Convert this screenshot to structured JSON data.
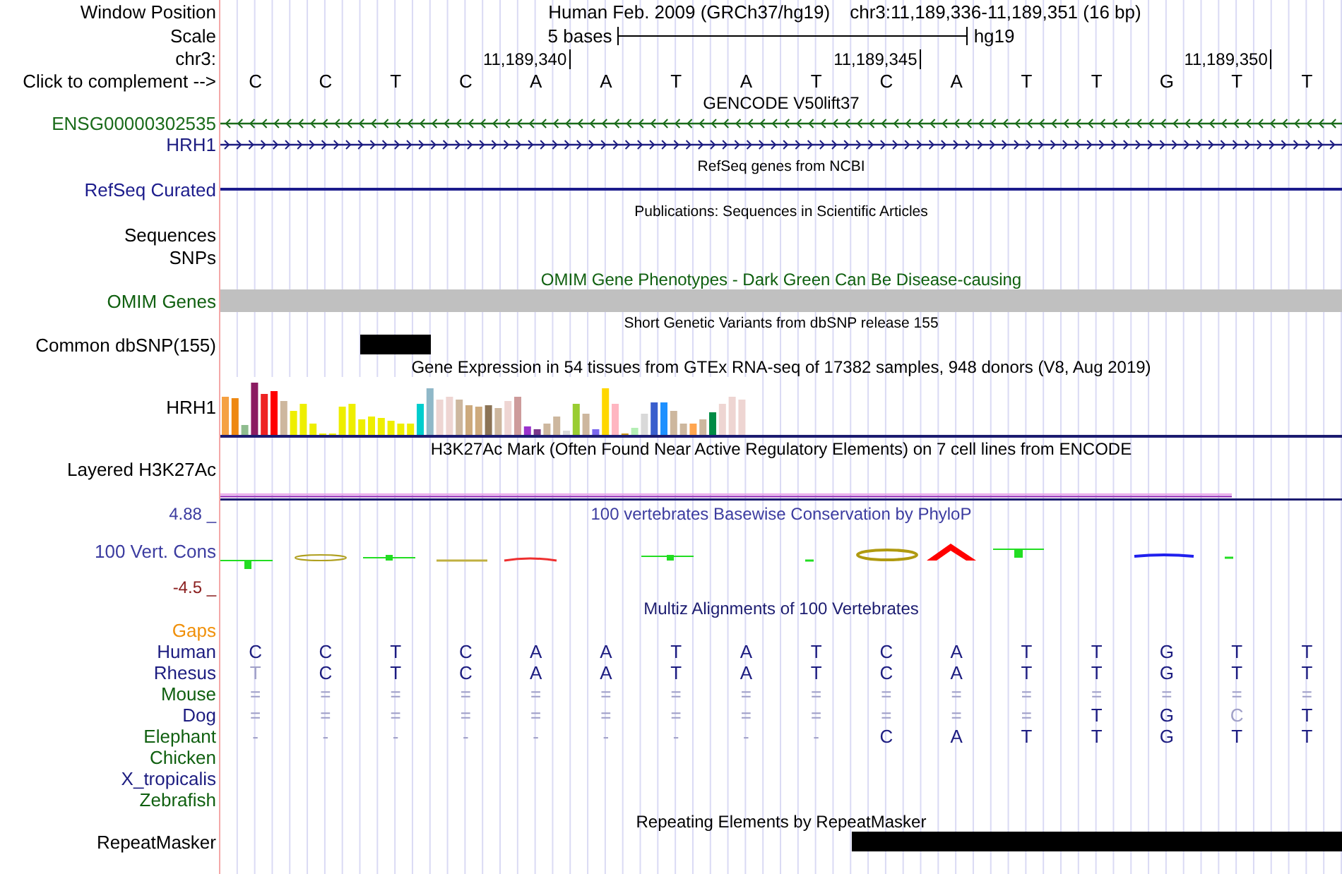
{
  "sequence": [
    {
      "base": "C"
    },
    {
      "base": "C"
    },
    {
      "base": "T"
    },
    {
      "base": "C"
    },
    {
      "base": "A",
      "coordinate": "11,189,340"
    },
    {
      "base": "A"
    },
    {
      "base": "T"
    },
    {
      "base": "A"
    },
    {
      "base": "T"
    },
    {
      "base": "C",
      "coordinate": "11,189,345"
    },
    {
      "base": "A"
    },
    {
      "base": "T"
    },
    {
      "base": "T"
    },
    {
      "base": "G"
    },
    {
      "base": "T",
      "coordinate": "11,189,350"
    },
    {
      "base": "T"
    }
  ],
  "rows": [
    {
      "kind": "position",
      "label": "Window Position",
      "assembly": "Human Feb. 2009 (GRCh37/hg19)",
      "range": "chr3:11,189,336-11,189,351 (16 bp)"
    },
    {
      "kind": "scale",
      "label": "Scale",
      "scale": "5 bases",
      "db": "hg19"
    },
    {
      "kind": "ruler",
      "label": "chr3:"
    },
    {
      "kind": "bases",
      "label": "Click to complement -->"
    },
    {
      "kind": "title",
      "text": "GENCODE V50lift37"
    },
    {
      "kind": "gene_reverse",
      "label": "ENSG00000302535",
      "color": "#1a6b1a"
    },
    {
      "kind": "gene_forward",
      "label": "HRH1",
      "color": "#1c1c80"
    },
    {
      "kind": "small_title",
      "text": "RefSeq genes from NCBI"
    },
    {
      "kind": "line",
      "label": "RefSeq Curated",
      "color": "#1c1c8c"
    },
    {
      "kind": "small_title",
      "text": "Publications: Sequences in Scientific Articles"
    },
    {
      "kind": "empty",
      "label": "Sequences"
    },
    {
      "kind": "empty",
      "label": "SNPs"
    },
    {
      "kind": "title",
      "text": "OMIM Gene Phenotypes - Dark Green Can Be Disease-causing",
      "color": "#106010"
    },
    {
      "kind": "band",
      "label": "OMIM Genes",
      "color": "#106010"
    },
    {
      "kind": "small_title",
      "text": "Short Genetic Variants from dbSNP release 155"
    },
    {
      "kind": "blocks",
      "label": "Common dbSNP(155)",
      "covered": [
        false,
        false,
        true,
        false,
        false,
        false,
        false,
        false,
        false,
        false,
        false,
        false,
        false,
        false,
        false,
        false
      ]
    },
    {
      "kind": "title",
      "text": "Gene Expression in 54 tissues from GTEx RNA-seq of 17382 samples, 948 donors (V8, Aug 2019)"
    },
    {
      "kind": "expression",
      "label": "HRH1"
    },
    {
      "kind": "title",
      "text": "H3K27Ac Mark (Often Found Near Active Regulatory Elements) on 7 cell lines from ENCODE"
    },
    {
      "kind": "layered",
      "label": "Layered H3K27Ac"
    },
    {
      "kind": "conservation",
      "label": "100 Vert. Cons",
      "color": "#3c3ca0",
      "title": "100 vertebrates Basewise Conservation by PhyloP",
      "max": "4.88 _",
      "min": "-4.5 _"
    },
    {
      "kind": "title",
      "text": "Multiz Alignments of 100 Vertebrates",
      "color": "#1c1c70"
    },
    {
      "kind": "empty",
      "label": "Gaps",
      "color": "#f0900a"
    },
    {
      "kind": "alignment",
      "label": "Human",
      "color": "#1c1c80",
      "bases": [
        {
          "base": "C",
          "faded": false
        },
        {
          "base": "C",
          "faded": false
        },
        {
          "base": "T",
          "faded": false
        },
        {
          "base": "C",
          "faded": false
        },
        {
          "base": "A",
          "faded": false
        },
        {
          "base": "A",
          "faded": false
        },
        {
          "base": "T",
          "faded": false
        },
        {
          "base": "A",
          "faded": false
        },
        {
          "base": "T",
          "faded": false
        },
        {
          "base": "C",
          "faded": false
        },
        {
          "base": "A",
          "faded": false
        },
        {
          "base": "T",
          "faded": false
        },
        {
          "base": "T",
          "faded": false
        },
        {
          "base": "G",
          "faded": false
        },
        {
          "base": "T",
          "faded": false
        },
        {
          "base": "T",
          "faded": false
        }
      ]
    },
    {
      "kind": "alignment",
      "label": "Rhesus",
      "color": "#1c1c80",
      "bases": [
        {
          "base": "T",
          "faded": true
        },
        {
          "base": "C",
          "faded": false
        },
        {
          "base": "T",
          "faded": false
        },
        {
          "base": "C",
          "faded": false
        },
        {
          "base": "A",
          "faded": false
        },
        {
          "base": "A",
          "faded": false
        },
        {
          "base": "T",
          "faded": false
        },
        {
          "base": "A",
          "faded": false
        },
        {
          "base": "T",
          "faded": false
        },
        {
          "base": "C",
          "faded": false
        },
        {
          "base": "A",
          "faded": false
        },
        {
          "base": "T",
          "faded": false
        },
        {
          "base": "T",
          "faded": false
        },
        {
          "base": "G",
          "faded": false
        },
        {
          "base": "T",
          "faded": false
        },
        {
          "base": "T",
          "faded": false
        }
      ]
    },
    {
      "kind": "alignment",
      "label": "Mouse",
      "color": "#106010",
      "bases": [
        {
          "base": "=",
          "faded": true
        },
        {
          "base": "=",
          "faded": true
        },
        {
          "base": "=",
          "faded": true
        },
        {
          "base": "=",
          "faded": true
        },
        {
          "base": "=",
          "faded": true
        },
        {
          "base": "=",
          "faded": true
        },
        {
          "base": "=",
          "faded": true
        },
        {
          "base": "=",
          "faded": true
        },
        {
          "base": "=",
          "faded": true
        },
        {
          "base": "=",
          "faded": true
        },
        {
          "base": "=",
          "faded": true
        },
        {
          "base": "=",
          "faded": true
        },
        {
          "base": "=",
          "faded": true
        },
        {
          "base": "=",
          "faded": true
        },
        {
          "base": "=",
          "faded": true
        },
        {
          "base": "=",
          "faded": true
        }
      ]
    },
    {
      "kind": "alignment",
      "label": "Dog",
      "color": "#1c1c80",
      "bases": [
        {
          "base": "=",
          "faded": true
        },
        {
          "base": "=",
          "faded": true
        },
        {
          "base": "=",
          "faded": true
        },
        {
          "base": "=",
          "faded": true
        },
        {
          "base": "=",
          "faded": true
        },
        {
          "base": "=",
          "faded": true
        },
        {
          "base": "=",
          "faded": true
        },
        {
          "base": "=",
          "faded": true
        },
        {
          "base": "=",
          "faded": true
        },
        {
          "base": "=",
          "faded": true
        },
        {
          "base": "=",
          "faded": true
        },
        {
          "base": "=",
          "faded": true
        },
        {
          "base": "T",
          "faded": false
        },
        {
          "base": "G",
          "faded": false
        },
        {
          "base": "C",
          "faded": true
        },
        {
          "base": "T",
          "faded": false
        }
      ]
    },
    {
      "kind": "alignment",
      "label": "Elephant",
      "color": "#106010",
      "bases": [
        {
          "base": "-",
          "faded": true
        },
        {
          "base": "-",
          "faded": true
        },
        {
          "base": "-",
          "faded": true
        },
        {
          "base": "-",
          "faded": true
        },
        {
          "base": "-",
          "faded": true
        },
        {
          "base": "-",
          "faded": true
        },
        {
          "base": "-",
          "faded": true
        },
        {
          "base": "-",
          "faded": true
        },
        {
          "base": "-",
          "faded": true
        },
        {
          "base": "C",
          "faded": false
        },
        {
          "base": "A",
          "faded": false
        },
        {
          "base": "T",
          "faded": false
        },
        {
          "base": "T",
          "faded": false
        },
        {
          "base": "G",
          "faded": false
        },
        {
          "base": "T",
          "faded": false
        },
        {
          "base": "T",
          "faded": false
        }
      ]
    },
    {
      "kind": "alignment",
      "label": "Chicken",
      "color": "#106010"
    },
    {
      "kind": "alignment",
      "label": "X_tropicalis",
      "color": "#1c1c80"
    },
    {
      "kind": "alignment",
      "label": "Zebrafish",
      "color": "#106010"
    },
    {
      "kind": "title",
      "text": "Repeating Elements by RepeatMasker"
    },
    {
      "kind": "blocks",
      "label": "RepeatMasker",
      "covered": [
        false,
        false,
        false,
        false,
        false,
        false,
        false,
        false,
        false,
        true,
        true,
        true,
        true,
        true,
        true,
        true
      ]
    }
  ]
}
